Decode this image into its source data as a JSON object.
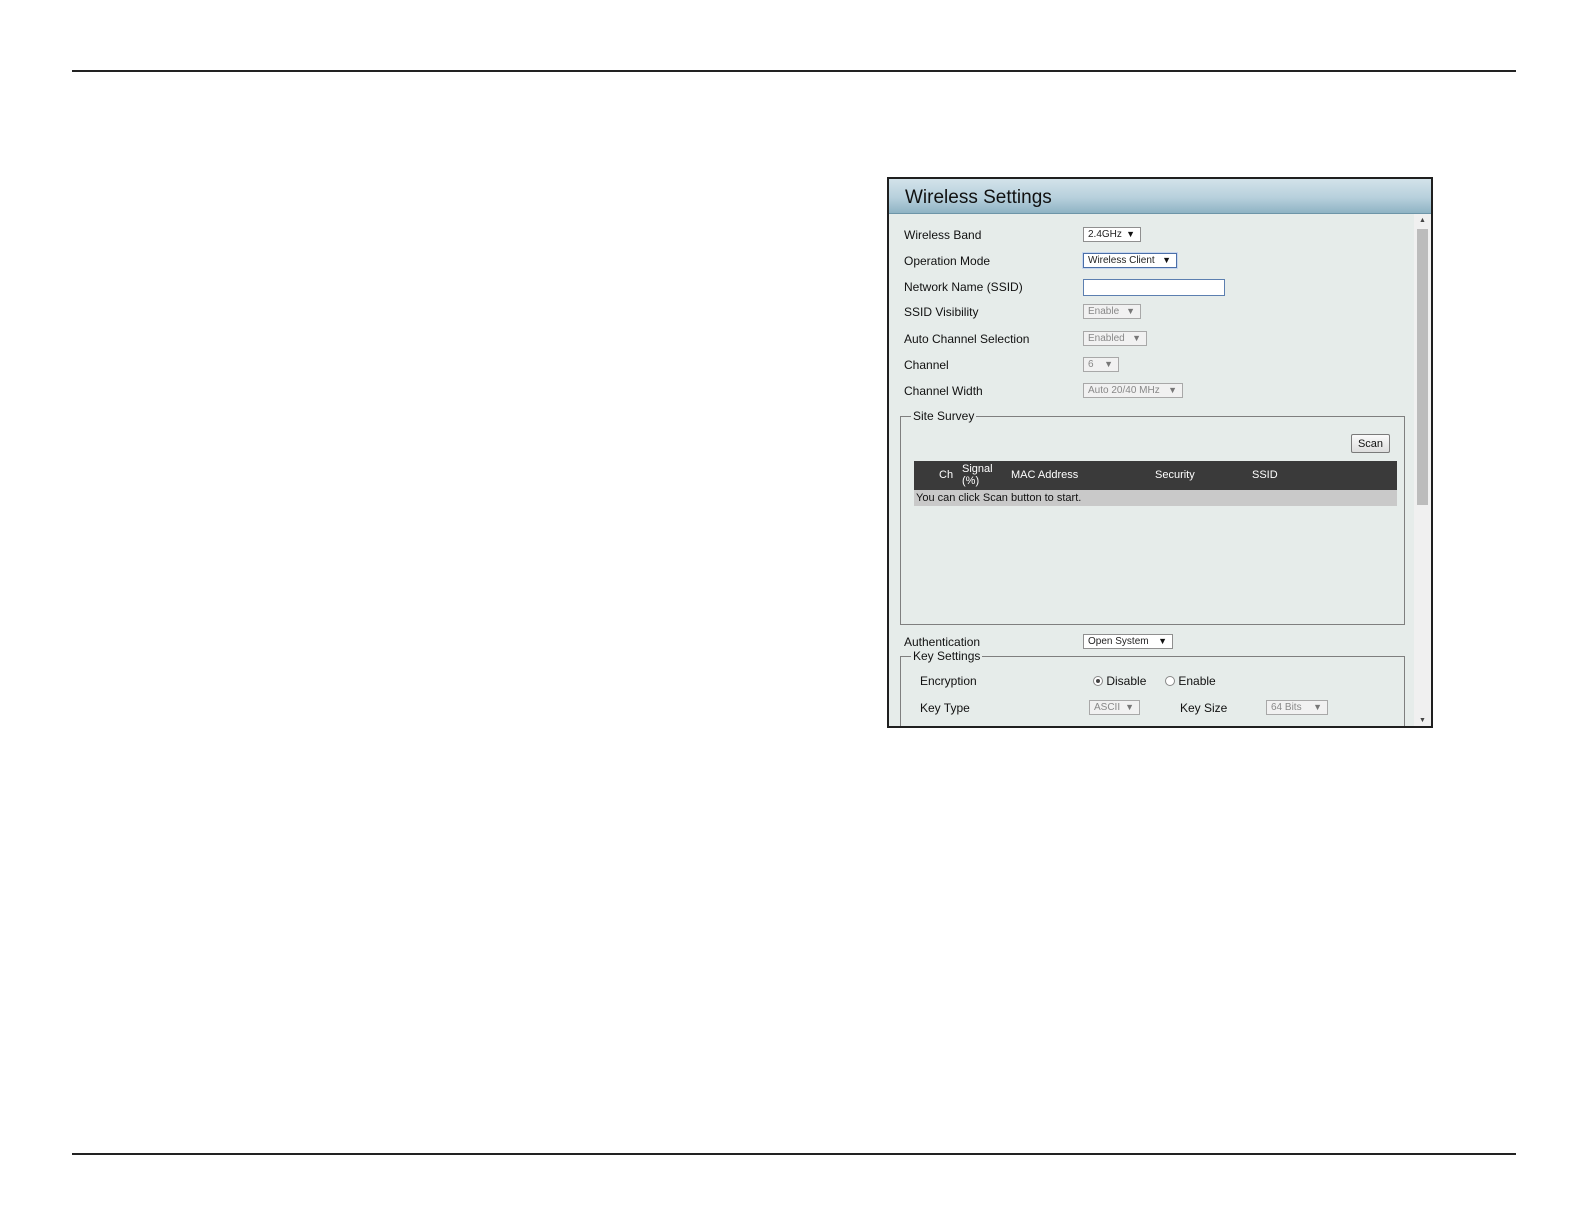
{
  "panel": {
    "title": "Wireless Settings",
    "fields": {
      "wireless_band": {
        "label": "Wireless Band",
        "value": "2.4GHz"
      },
      "operation_mode": {
        "label": "Operation Mode",
        "value": "Wireless Client"
      },
      "ssid": {
        "label": "Network Name (SSID)",
        "value": ""
      },
      "ssid_visibility": {
        "label": "SSID Visibility",
        "value": "Enable"
      },
      "auto_channel": {
        "label": "Auto Channel Selection",
        "value": "Enabled"
      },
      "channel": {
        "label": "Channel",
        "value": "6"
      },
      "channel_width": {
        "label": "Channel Width",
        "value": "Auto 20/40 MHz"
      },
      "authentication": {
        "label": "Authentication",
        "value": "Open System"
      }
    },
    "site_survey": {
      "legend": "Site Survey",
      "scan_label": "Scan",
      "columns": {
        "ch": "Ch",
        "signal_line1": "Signal",
        "signal_line2": "(%)",
        "mac": "MAC Address",
        "security": "Security",
        "ssid": "SSID"
      },
      "message": "You can click Scan button to start."
    },
    "key_settings": {
      "legend": "Key Settings",
      "encryption_label": "Encryption",
      "encryption_options": [
        "Disable",
        "Enable"
      ],
      "encryption_selected": "Disable",
      "key_type_label": "Key Type",
      "key_type_value": "ASCII",
      "key_size_label": "Key Size",
      "key_size_value": "64 Bits"
    }
  }
}
